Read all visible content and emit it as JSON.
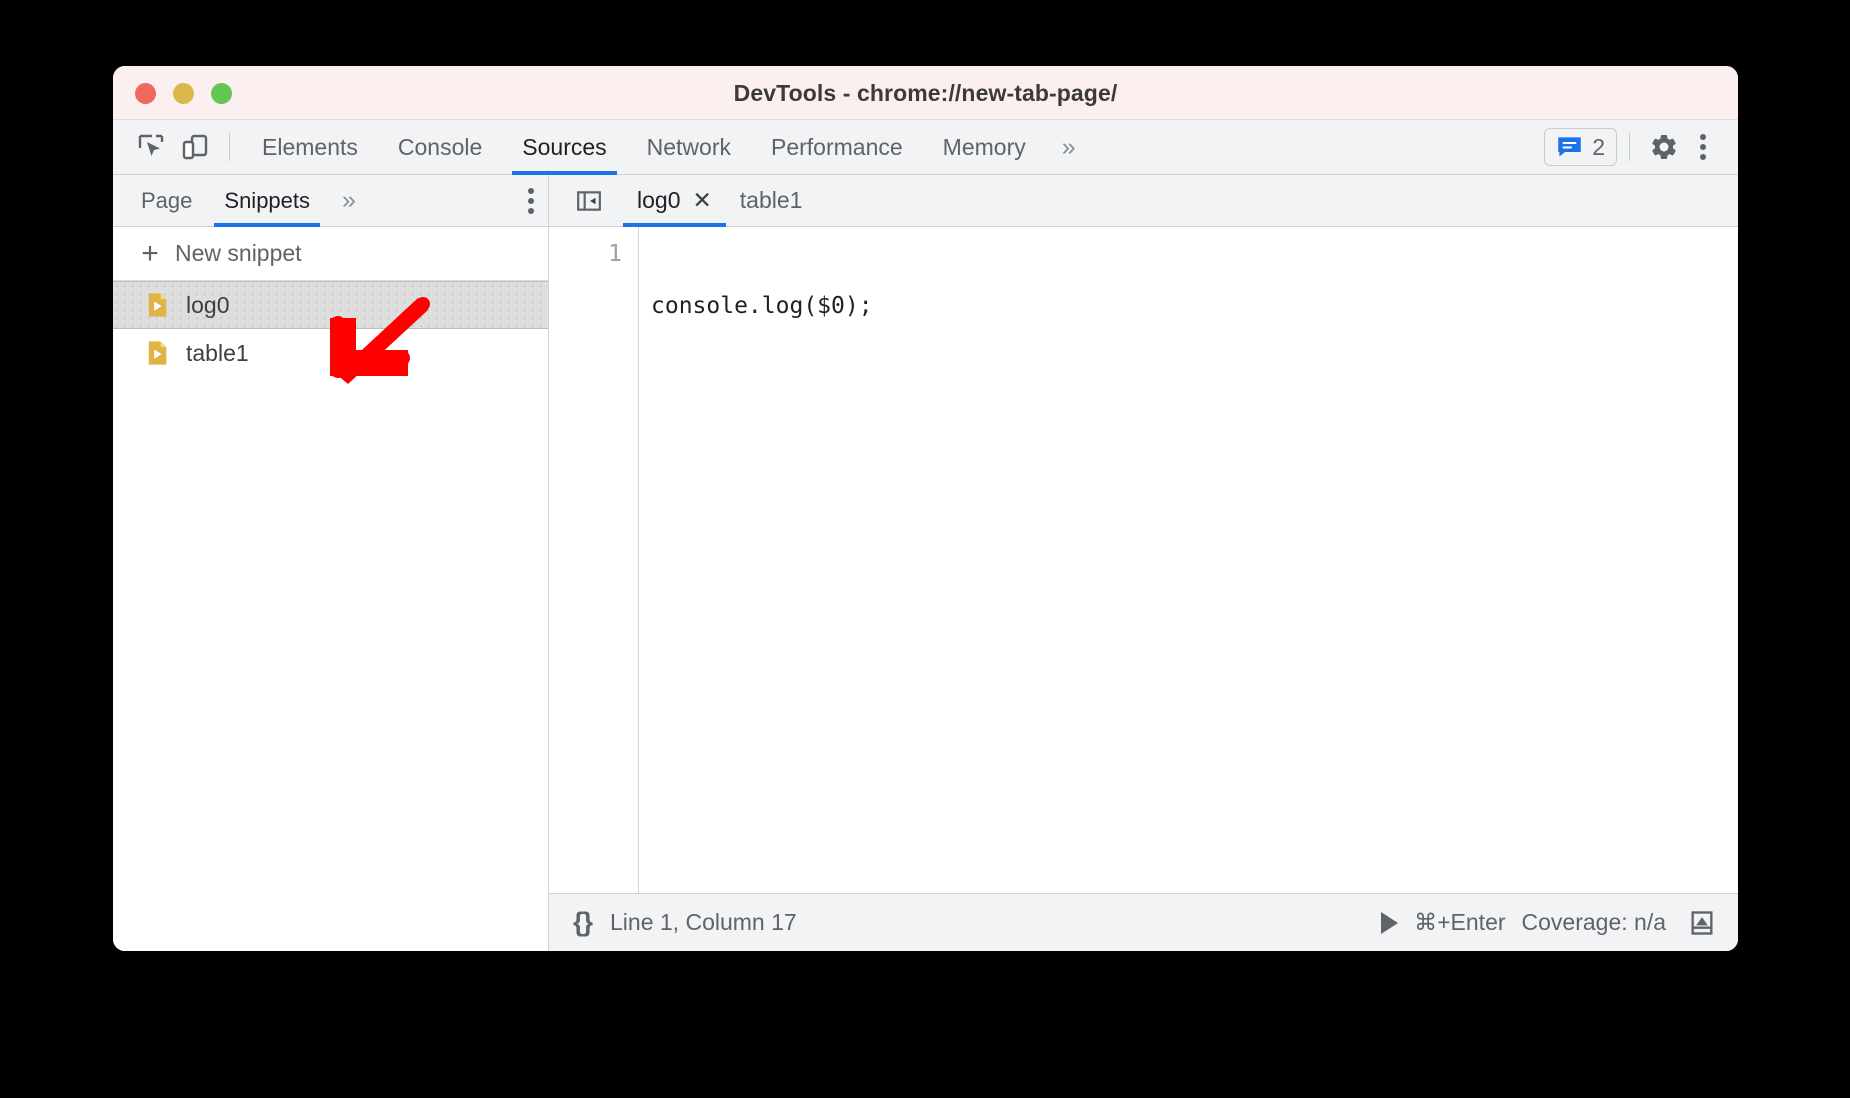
{
  "window": {
    "title": "DevTools - chrome://new-tab-page/",
    "traffic_lights": {
      "close": "close-window",
      "minimize": "minimize-window",
      "maximize": "maximize-window"
    },
    "colors": {
      "titlebar_bg": "#fbf0ef",
      "toolbar_bg": "#f1f3f4",
      "accent": "#1a73e8",
      "snippet_icon": "#dfb345",
      "annotation_arrow": "#fe0000",
      "selected_row": "#dedede"
    }
  },
  "toolbar": {
    "inspect_icon": "inspect-element-icon",
    "device_icon": "device-toolbar-icon",
    "panels": [
      {
        "label": "Elements",
        "active": false
      },
      {
        "label": "Console",
        "active": false
      },
      {
        "label": "Sources",
        "active": true
      },
      {
        "label": "Network",
        "active": false
      },
      {
        "label": "Performance",
        "active": false
      },
      {
        "label": "Memory",
        "active": false
      }
    ],
    "more_panels": "»",
    "messages": {
      "icon": "message-icon",
      "count": "2"
    },
    "settings_icon": "gear-icon",
    "menu_icon": "kebab-menu-icon"
  },
  "sidebar": {
    "tabs": [
      {
        "label": "Page",
        "active": false
      },
      {
        "label": "Snippets",
        "active": true
      }
    ],
    "more_tabs": "»",
    "menu_icon": "kebab-menu-icon",
    "new_snippet": {
      "plus": "+",
      "label": "New snippet"
    },
    "snippets": [
      {
        "name": "log0",
        "selected": true
      },
      {
        "name": "table1",
        "selected": false
      }
    ]
  },
  "editor": {
    "collapse_icon": "collapse-sidebar-icon",
    "tabs": [
      {
        "label": "log0",
        "active": true,
        "closable": true,
        "close": "✕"
      },
      {
        "label": "table1",
        "active": false,
        "closable": false,
        "close": ""
      }
    ],
    "lines": [
      {
        "number": "1",
        "text": "console.log($0);"
      }
    ]
  },
  "statusbar": {
    "pretty_print": "{}",
    "cursor_position": "Line 1, Column 17",
    "run_icon": "play-icon",
    "run_shortcut": "⌘+Enter",
    "coverage": "Coverage: n/a",
    "drawer_icon": "drawer-toggle-icon"
  },
  "annotation": {
    "arrow": "red-arrow-pointing-down-left"
  }
}
